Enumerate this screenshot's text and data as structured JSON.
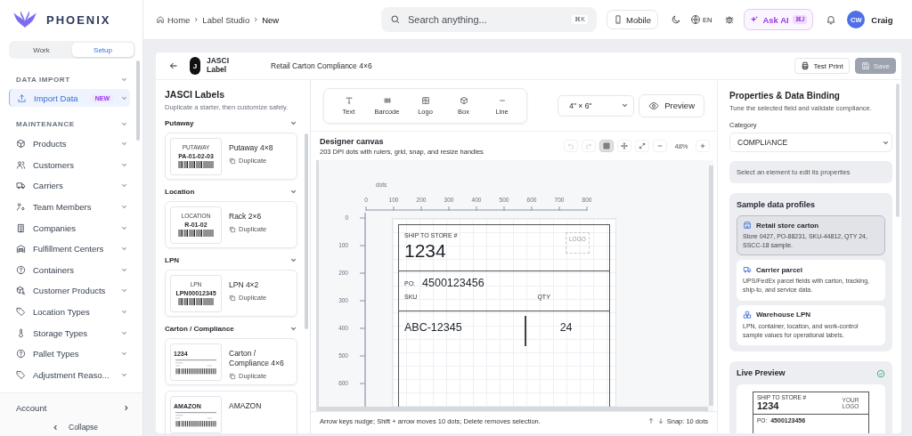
{
  "sidebar": {
    "logo": "PHOENIX",
    "tabs": [
      {
        "label": "Work",
        "selected": false
      },
      {
        "label": "Setup",
        "selected": true
      }
    ],
    "sections": [
      {
        "title": "DATA IMPORT",
        "expanded": true,
        "items": [
          {
            "label": "Import Data",
            "badge": "NEW",
            "selected": true
          }
        ]
      },
      {
        "title": "MAINTENANCE",
        "expanded": true,
        "items": [
          {
            "label": "Products",
            "selected": false
          },
          {
            "label": "Customers",
            "selected": false
          },
          {
            "label": "Carriers",
            "selected": false
          },
          {
            "label": "Team Members",
            "selected": false
          },
          {
            "label": "Companies",
            "selected": false
          },
          {
            "label": "Fulfillment Centers",
            "selected": false
          },
          {
            "label": "Containers",
            "selected": false
          },
          {
            "label": "Customer Products",
            "selected": false
          },
          {
            "label": "Location Types",
            "selected": false
          },
          {
            "label": "Storage Types",
            "selected": false
          },
          {
            "label": "Pallet Types",
            "selected": false
          },
          {
            "label": "Adjustment Reaso...",
            "selected": false
          }
        ]
      }
    ],
    "account": "Account",
    "collapse": "Collapse"
  },
  "topbar": {
    "breadcrumbs": [
      "Home",
      "Label Studio",
      "New"
    ],
    "search": {
      "placeholder": "Search anything...",
      "shortcut": "⌘K"
    },
    "mobile": "Mobile",
    "language": "EN",
    "ask_ai": {
      "label": "Ask AI",
      "shortcut": "⌘J"
    },
    "user": {
      "initials": "CW",
      "name": "Craig"
    }
  },
  "editor": {
    "app_badge": "J",
    "app_name": "JASCI Label",
    "title": "Retail Carton Compliance 4×6",
    "test_print": "Test Print",
    "save": {
      "label": "Save",
      "disabled": true
    }
  },
  "library": {
    "title": "JASCI Labels",
    "subtitle": "Duplicate a starter, then customize safely.",
    "groups": [
      {
        "name": "Putaway",
        "expanded": true,
        "templates": [
          {
            "kind": "simple",
            "name": "Putaway 4×8",
            "thumb_caption": "PUTAWAY",
            "thumb_code": "PA-01-02-03",
            "action": "Duplicate"
          }
        ]
      },
      {
        "name": "Location",
        "expanded": true,
        "templates": [
          {
            "kind": "simple",
            "name": "Rack 2×6",
            "thumb_caption": "LOCATION",
            "thumb_code": "R-01-02",
            "action": "Duplicate"
          }
        ]
      },
      {
        "name": "LPN",
        "expanded": true,
        "templates": [
          {
            "kind": "simple",
            "name": "LPN 4×2",
            "thumb_caption": "LPN",
            "thumb_code": "LPN00012345",
            "action": "Duplicate"
          }
        ]
      },
      {
        "name": "Carton / Compliance",
        "expanded": true,
        "templates": [
          {
            "kind": "compliance",
            "name": "Carton / Compliance 4×6",
            "thumb_code": "1234",
            "action": "Duplicate"
          },
          {
            "kind": "compliance",
            "name": "AMAZON",
            "thumb_code": "AMAZON"
          }
        ]
      }
    ]
  },
  "toolbar": {
    "tools": [
      {
        "label": "Text"
      },
      {
        "label": "Barcode"
      },
      {
        "label": "Logo"
      },
      {
        "label": "Box"
      },
      {
        "label": "Line"
      }
    ],
    "size": "4\" × 6\"",
    "preview": "Preview"
  },
  "canvas": {
    "title": "Designer canvas",
    "subtitle": "203 DPI dots with rulers, grid, snap, and resize handles",
    "undo_disabled": true,
    "redo_disabled": true,
    "grid_on": true,
    "zoom": "48%",
    "ruler_unit": "dots",
    "x_ticks": [
      "0",
      "100",
      "200",
      "300",
      "400",
      "500",
      "600",
      "700",
      "800"
    ],
    "y_ticks": [
      "0",
      "100",
      "200",
      "300",
      "400",
      "500",
      "600"
    ],
    "label": {
      "store_caption": "SHIP TO STORE #",
      "store": "1234",
      "logo": "LOGO",
      "po_caption": "PO:",
      "po": "4500123456",
      "sku_caption": "SKU",
      "qty_caption": "QTY",
      "sku": "ABC-12345",
      "qty": "24"
    },
    "hint": "Arrow keys nudge; Shift + arrow moves 10 dots; Delete removes selection.",
    "snap": "Snap: 10 dots"
  },
  "properties": {
    "title": "Properties & Data Binding",
    "subtitle": "Tune the selected field and validate compliance.",
    "category_label": "Category",
    "category": "COMPLIANCE",
    "empty_hint": "Select an element to edit its properties",
    "profiles_title": "Sample data profiles",
    "profiles": [
      {
        "name": "Retail store carton",
        "description": "Store 0427, PO-88231, SKU-44812, QTY 24, SSCC-18 sample.",
        "selected": true
      },
      {
        "name": "Carrier parcel",
        "description": "UPS/FedEx parcel fields with carton, tracking, ship-to, and service data.",
        "selected": false
      },
      {
        "name": "Warehouse LPN",
        "description": "LPN, container, location, and work-control sample values for operational labels.",
        "selected": false
      }
    ],
    "live_preview": {
      "title": "Live Preview",
      "valid": true,
      "store_caption": "SHIP TO STORE #",
      "store": "1234",
      "logo": "YOUR LOGO",
      "po_caption": "PO:",
      "po": "4500123456"
    }
  }
}
